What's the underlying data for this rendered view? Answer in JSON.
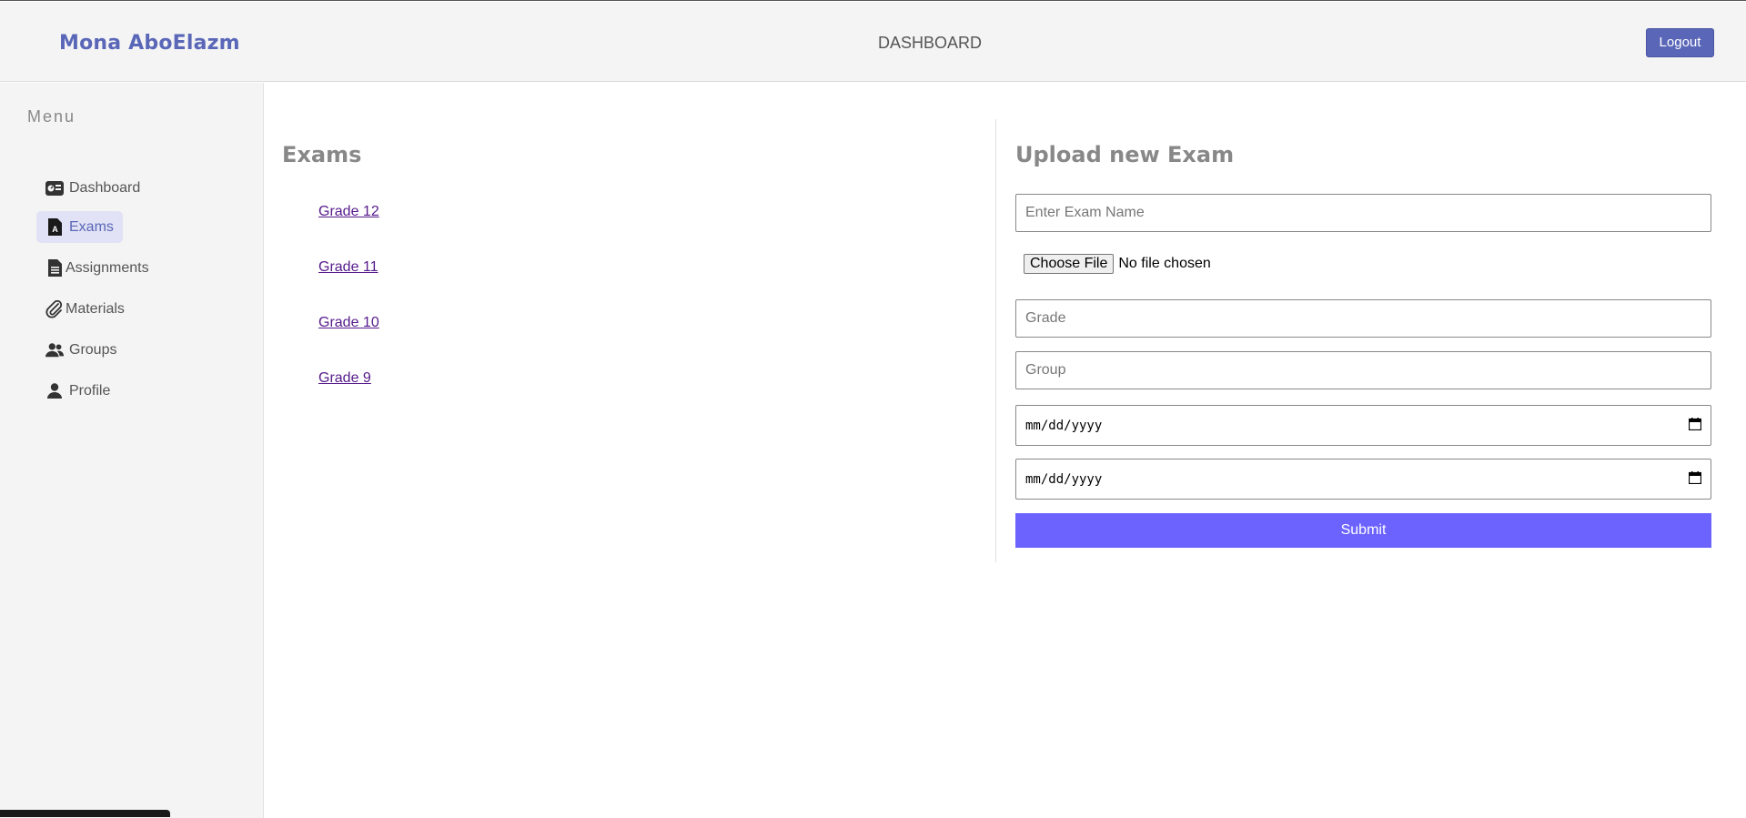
{
  "header": {
    "brand": "Mona AboElazm",
    "title": "DASHBOARD",
    "logout_label": "Logout"
  },
  "sidebar": {
    "menu_label": "Menu",
    "items": [
      {
        "label": "Dashboard",
        "icon": "dashboard-icon",
        "active": false
      },
      {
        "label": "Exams",
        "icon": "exam-file-icon",
        "active": true
      },
      {
        "label": "Assignments",
        "icon": "document-icon",
        "active": false
      },
      {
        "label": "Materials",
        "icon": "paperclip-icon",
        "active": false
      },
      {
        "label": "Groups",
        "icon": "users-icon",
        "active": false
      },
      {
        "label": "Profile",
        "icon": "user-icon",
        "active": false
      }
    ]
  },
  "exams": {
    "title": "Exams",
    "grades": [
      "Grade 12",
      "Grade 11",
      "Grade 10",
      "Grade 9"
    ]
  },
  "upload": {
    "title": "Upload new Exam",
    "exam_name_placeholder": "Enter Exam Name",
    "choose_file_label": "Choose File",
    "file_status": "No file chosen",
    "grade_placeholder": "Grade",
    "group_placeholder": "Group",
    "date_placeholder_1": "mm/dd/yyyy",
    "date_placeholder_2": "mm/dd/yyyy",
    "submit_label": "Submit"
  },
  "colors": {
    "accent": "#5a67b8",
    "submit": "#6c63ff",
    "link": "#551a8b"
  }
}
